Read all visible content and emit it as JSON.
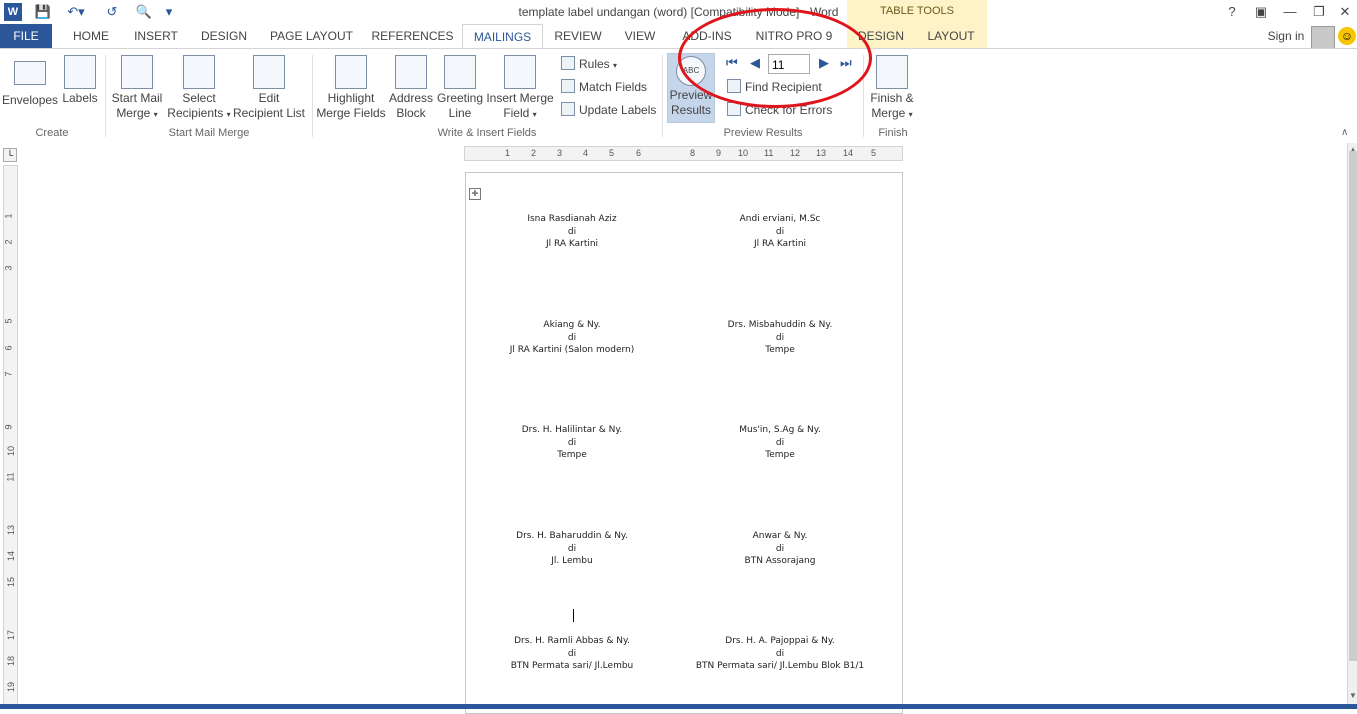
{
  "window": {
    "title": "template label undangan (word) [Compatibility Mode] - Word",
    "table_tools_label": "TABLE TOOLS",
    "help": "?",
    "sign_in": "Sign in"
  },
  "tabs": [
    "FILE",
    "HOME",
    "INSERT",
    "DESIGN",
    "PAGE LAYOUT",
    "REFERENCES",
    "MAILINGS",
    "REVIEW",
    "VIEW",
    "ADD-INS",
    "NITRO PRO 9",
    "DESIGN",
    "LAYOUT"
  ],
  "active_tab": "MAILINGS",
  "ribbon": {
    "create": {
      "label": "Create",
      "envelopes": "Envelopes",
      "labels": "Labels"
    },
    "start_mail_merge": {
      "label": "Start Mail Merge",
      "start_line1": "Start Mail",
      "start_line2": "Merge",
      "select_line1": "Select",
      "select_line2": "Recipients",
      "edit_line1": "Edit",
      "edit_line2": "Recipient List"
    },
    "write_insert": {
      "label": "Write & Insert Fields",
      "highlight_line1": "Highlight",
      "highlight_line2": "Merge Fields",
      "address_line1": "Address",
      "address_line2": "Block",
      "greeting_line1": "Greeting",
      "greeting_line2": "Line",
      "insert_line1": "Insert Merge",
      "insert_line2": "Field",
      "rules": "Rules",
      "match_fields": "Match Fields",
      "update_labels": "Update Labels"
    },
    "preview": {
      "label": "Preview Results",
      "preview_line1": "Preview",
      "preview_line2": "Results",
      "record": "11",
      "find_recipient": "Find Recipient",
      "check_errors": "Check for Errors"
    },
    "finish": {
      "label": "Finish",
      "line1": "Finish &",
      "line2": "Merge"
    }
  },
  "ruler": {
    "h_ticks": [
      "1",
      "2",
      "3",
      "4",
      "5",
      "6",
      "8",
      "9",
      "10",
      "11",
      "12",
      "13",
      "14",
      "5"
    ],
    "v_ticks": [
      "1",
      "2",
      "3",
      "5",
      "6",
      "7",
      "9",
      "10",
      "11",
      "13",
      "14",
      "15",
      "17",
      "18",
      "19"
    ]
  },
  "labels": [
    {
      "name": "Isna Rasdianah Aziz",
      "di": "di",
      "addr": "Jl RA Kartini"
    },
    {
      "name": "Andi erviani, M.Sc",
      "di": "di",
      "addr": "Jl RA Kartini"
    },
    {
      "name": "Akiang & Ny.",
      "di": "di",
      "addr": "Jl RA Kartini (Salon modern)"
    },
    {
      "name": "Drs. Misbahuddin & Ny.",
      "di": "di",
      "addr": "Tempe"
    },
    {
      "name": "Drs. H. Halilintar & Ny.",
      "di": "di",
      "addr": "Tempe"
    },
    {
      "name": "Mus'in, S.Ag & Ny.",
      "di": "di",
      "addr": "Tempe"
    },
    {
      "name": "Drs. H. Baharuddin & Ny.",
      "di": "di",
      "addr": "Jl. Lembu"
    },
    {
      "name": "Anwar & Ny.",
      "di": "di",
      "addr": "BTN Assorajang"
    },
    {
      "name": "Drs. H. Ramli Abbas & Ny.",
      "di": "di",
      "addr": "BTN Permata sari/ Jl.Lembu"
    },
    {
      "name": "Drs. H. A. Pajoppai & Ny.",
      "di": "di",
      "addr": "BTN Permata sari/ Jl.Lembu Blok B1/1"
    }
  ]
}
